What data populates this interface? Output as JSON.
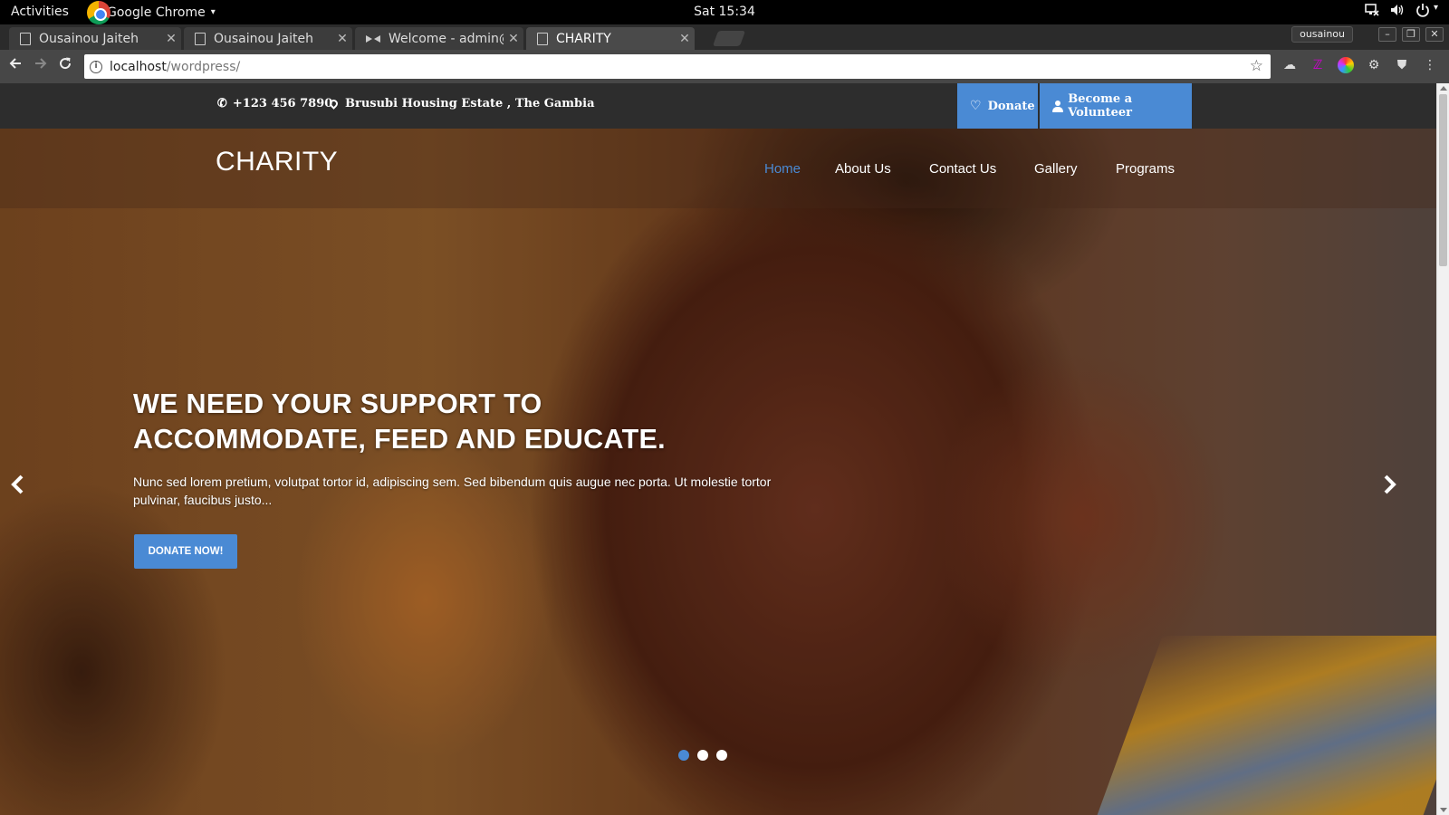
{
  "system": {
    "activities": "Activities",
    "app_name": "Google Chrome",
    "app_caret": "▾",
    "clock": "Sat 15:34",
    "tray_icons": [
      "network-icon",
      "volume-icon",
      "power-icon"
    ]
  },
  "browser": {
    "tabs": [
      {
        "title": "Ousainou Jaiteh",
        "icon": "page-icon"
      },
      {
        "title": "Ousainou Jaiteh",
        "icon": "page-icon"
      },
      {
        "title": "Welcome - admin@",
        "icon": "bow-icon"
      },
      {
        "title": "CHARITY",
        "icon": "page-icon",
        "active": true
      }
    ],
    "tab_close": "✕",
    "profile": "ousainou",
    "window_buttons": [
      "–",
      "❐",
      "✕"
    ],
    "url_host": "localhost",
    "url_path": "/wordpress/",
    "info_glyph": "i",
    "extensions": [
      "cloud-icon",
      "extension-icon",
      "color-wheel-icon",
      "gear-icon",
      "shield-icon",
      "menu-icon"
    ]
  },
  "site": {
    "topbar": {
      "phone": "+123 456 7890",
      "address": "Brusubi Housing Estate , The Gambia",
      "donate_label": "Donate",
      "volunteer_label": "Become a Volunteer"
    },
    "logo": "CHARITY",
    "nav": [
      {
        "label": "Home",
        "active": true
      },
      {
        "label": "About Us"
      },
      {
        "label": "Contact Us"
      },
      {
        "label": "Gallery"
      },
      {
        "label": "Programs"
      }
    ],
    "slide": {
      "title_line1": "WE NEED YOUR SUPPORT TO",
      "title_line2": "ACCOMMODATE, FEED AND EDUCATE.",
      "text": "Nunc sed lorem pretium, volutpat tortor id, adipiscing sem. Sed bibendum quis augue nec porta. Ut molestie tortor pulvinar, faucibus justo...",
      "cta": "DONATE NOW!",
      "prev_glyph": "‹",
      "next_glyph": "›",
      "dot_count": 3,
      "active_dot": 0
    },
    "colors": {
      "accent": "#4a8ad4",
      "topbar_bg": "#2d2d2d"
    }
  }
}
